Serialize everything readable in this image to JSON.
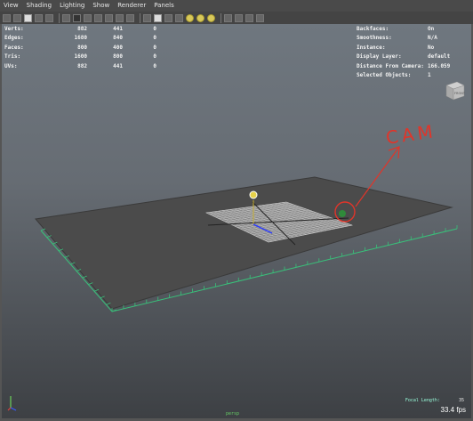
{
  "menu": [
    "View",
    "Shading",
    "Lighting",
    "Show",
    "Renderer",
    "Panels"
  ],
  "hud_left": {
    "rows": [
      {
        "label": "Verts:",
        "v1": "882",
        "v2": "441",
        "v3": "0"
      },
      {
        "label": "Edges:",
        "v1": "1680",
        "v2": "840",
        "v3": "0"
      },
      {
        "label": "Faces:",
        "v1": "800",
        "v2": "400",
        "v3": "0"
      },
      {
        "label": "Tris:",
        "v1": "1600",
        "v2": "800",
        "v3": "0"
      },
      {
        "label": "UVs:",
        "v1": "882",
        "v2": "441",
        "v3": "0"
      }
    ]
  },
  "hud_right": {
    "rows": [
      {
        "label": "Backfaces:",
        "value": "On"
      },
      {
        "label": "Smoothness:",
        "value": "N/A"
      },
      {
        "label": "Instance:",
        "value": "No"
      },
      {
        "label": "Display Layer:",
        "value": "default"
      },
      {
        "label": "Distance From Camera:",
        "value": "166.059"
      },
      {
        "label": "Selected Objects:",
        "value": "1"
      }
    ]
  },
  "annotation": {
    "text": "CAM",
    "color": "#e0352a"
  },
  "focal_length": {
    "label": "Focal Length:",
    "value": "35"
  },
  "fps": "33.4 fps",
  "camera_name": "persp",
  "viewcube_label": "FRONT",
  "colors": {
    "grid": "#39c07a",
    "plane": "#4a4a4a",
    "annotation": "#e0352a"
  }
}
